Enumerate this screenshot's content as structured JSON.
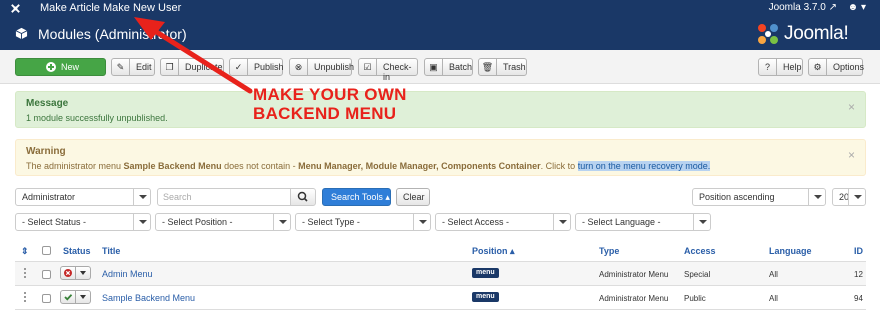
{
  "topbar": {
    "menu": [
      "Make Article",
      "Make New User"
    ],
    "version": "Joomla 3.7.0",
    "user_icon": "user-icon",
    "logo_icon": "joomla-icon"
  },
  "header": {
    "title": "Modules (Administrator)",
    "brand": "Joomla!",
    "module_icon": "cube-icon"
  },
  "toolbar": {
    "new": "New",
    "edit": "Edit",
    "duplicate": "Duplicate",
    "publish": "Publish",
    "unpublish": "Unpublish",
    "checkin": "Check-in",
    "batch": "Batch",
    "trash": "Trash",
    "help": "Help",
    "options": "Options"
  },
  "alerts": {
    "success": {
      "heading": "Message",
      "text": "1 module successfully unpublished."
    },
    "warning": {
      "heading": "Warning",
      "text_pre": "The administrator menu ",
      "menu_name": "Sample Backend Menu",
      "text_mid": " does not contain - ",
      "missing": "Menu Manager, Module Manager, Components Container",
      "text_post": ". Click to ",
      "link": "turn on the menu recovery mode."
    }
  },
  "filters": {
    "client": "Administrator",
    "search_placeholder": "Search",
    "search_tools": "Search Tools ▴",
    "clear": "Clear",
    "ordering": "Position ascending",
    "limit": "20",
    "status": "- Select Status -",
    "position": "- Select Position -",
    "type": "- Select Type -",
    "access": "- Select Access -",
    "language": "- Select Language -"
  },
  "table": {
    "headers": {
      "status": "Status",
      "title": "Title",
      "position": "Position ▴",
      "type": "Type",
      "access": "Access",
      "language": "Language",
      "id": "ID"
    },
    "rows": [
      {
        "title": "Admin Menu",
        "position": "menu",
        "type": "Administrator Menu",
        "access": "Special",
        "language": "All",
        "id": "12",
        "status": "unpublished"
      },
      {
        "title": "Sample Backend Menu",
        "position": "menu",
        "type": "Administrator Menu",
        "access": "Public",
        "language": "All",
        "id": "94",
        "status": "published"
      }
    ]
  },
  "annotation": {
    "line1": "MAKE YOUR OWN",
    "line2": "BACKEND MENU",
    "color": "#e8221b"
  },
  "colors": {
    "header": "#1a3867",
    "new_button": "#46a546",
    "search_tools": "#2f7ed8"
  }
}
